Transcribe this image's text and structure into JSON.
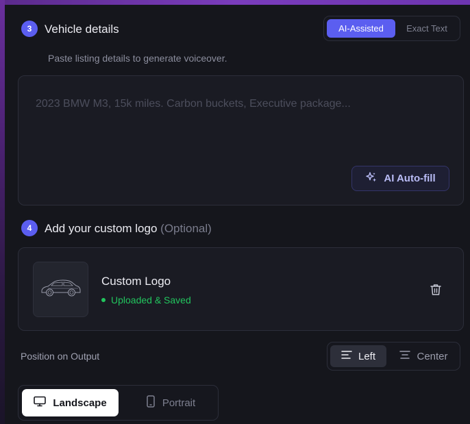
{
  "step3": {
    "number": "3",
    "title": "Vehicle details",
    "subtitle": "Paste listing details to generate voiceover.",
    "mode": {
      "active": "AI-Assisted",
      "inactive": "Exact Text"
    },
    "placeholder": "2023 BMW M3, 15k miles. Carbon buckets, Executive package...",
    "autofill_label": "AI Auto-fill"
  },
  "step4": {
    "number": "4",
    "title": "Add your custom logo",
    "optional": "(Optional)",
    "logo": {
      "name": "Custom Logo",
      "status": "Uploaded & Saved",
      "status_color": "#22c55e"
    }
  },
  "position": {
    "label": "Position on Output",
    "options": [
      "Left",
      "Center"
    ],
    "selected": "Left"
  },
  "orientation": {
    "options": [
      "Landscape",
      "Portrait"
    ],
    "selected": "Landscape"
  },
  "colors": {
    "accent": "#5b5ef0",
    "background": "#15161c",
    "card": "#1a1b23",
    "success": "#22c55e"
  },
  "icons": {
    "autofill": "sparkles-icon",
    "logo": "car-icon",
    "delete": "trash-icon",
    "align_left": "align-left-icon",
    "align_center": "align-center-icon",
    "landscape": "monitor-icon",
    "portrait": "phone-icon"
  }
}
